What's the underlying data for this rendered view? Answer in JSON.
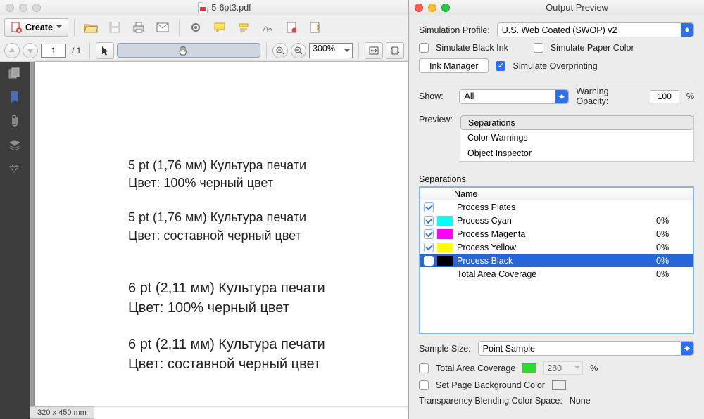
{
  "main": {
    "filename": "5-6pt3.pdf",
    "create_label": "Create",
    "page_current": "1",
    "page_total_label": "/  1",
    "zoom": "300%",
    "status": "320 x 450 mm"
  },
  "doc": {
    "b1_l1": "5 pt  (1,76 мм)   Культура печати",
    "b1_l2": "Цвет: 100% черный цвет",
    "b2_l1": "5 pt  (1,76 мм)   Культура печати",
    "b2_l2": "Цвет: составной черный цвет",
    "b3_l1": "6 pt  (2,11 мм)   Культура печати",
    "b3_l2": "Цвет: 100% черный цвет",
    "b4_l1": "6 pt  (2,11 мм)   Культура печати",
    "b4_l2": "Цвет: составной черный цвет"
  },
  "op": {
    "title": "Output Preview",
    "sim_profile_lbl": "Simulation Profile:",
    "sim_profile_val": "U.S. Web Coated (SWOP) v2",
    "sim_black_ink": "Simulate Black Ink",
    "sim_paper_color": "Simulate Paper Color",
    "ink_manager": "Ink Manager",
    "sim_overprint": "Simulate Overprinting",
    "show_lbl": "Show:",
    "show_val": "All",
    "warn_opacity_lbl": "Warning Opacity:",
    "warn_opacity_val": "100",
    "percent": "%",
    "preview_lbl": "Preview:",
    "preview_items": {
      "a": "Separations",
      "b": "Color Warnings",
      "c": "Object Inspector"
    },
    "sep_section": "Separations",
    "col_name": "Name",
    "rows": {
      "r1": {
        "name": "Process Plates",
        "val": ""
      },
      "r2": {
        "name": "Process Cyan",
        "val": "0%"
      },
      "r3": {
        "name": "Process Magenta",
        "val": "0%"
      },
      "r4": {
        "name": "Process Yellow",
        "val": "0%"
      },
      "r5": {
        "name": "Process Black",
        "val": "0%"
      },
      "r6": {
        "name": "Total Area Coverage",
        "val": "0%"
      }
    },
    "sample_size_lbl": "Sample Size:",
    "sample_size_val": "Point Sample",
    "total_area_cov": "Total Area Coverage",
    "tac_val": "280",
    "set_bg": "Set Page Background Color",
    "tbcs_lbl": "Transparency Blending Color Space:",
    "tbcs_val": "None"
  }
}
